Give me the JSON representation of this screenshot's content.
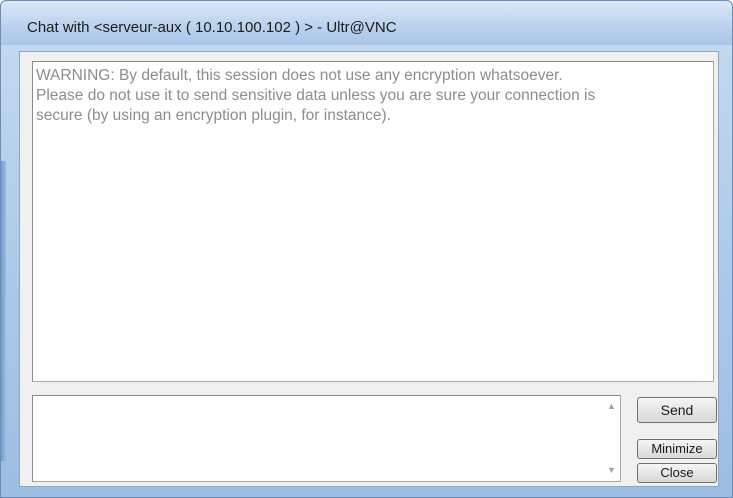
{
  "window": {
    "title": "Chat with <serveur-aux ( 10.10.100.102 ) > - Ultr@VNC"
  },
  "chat_log": {
    "lines": [
      "WARNING: By default, this session does not use any encryption whatsoever.",
      "Please do not use it to send sensitive data unless you are sure your connection is",
      "secure (by using an encryption plugin, for instance)."
    ]
  },
  "input": {
    "value": "",
    "scroll_up_icon": "scroll-up-arrow",
    "scroll_down_icon": "scroll-down-arrow"
  },
  "buttons": {
    "send": "Send",
    "minimize": "Minimize",
    "close": "Close"
  }
}
